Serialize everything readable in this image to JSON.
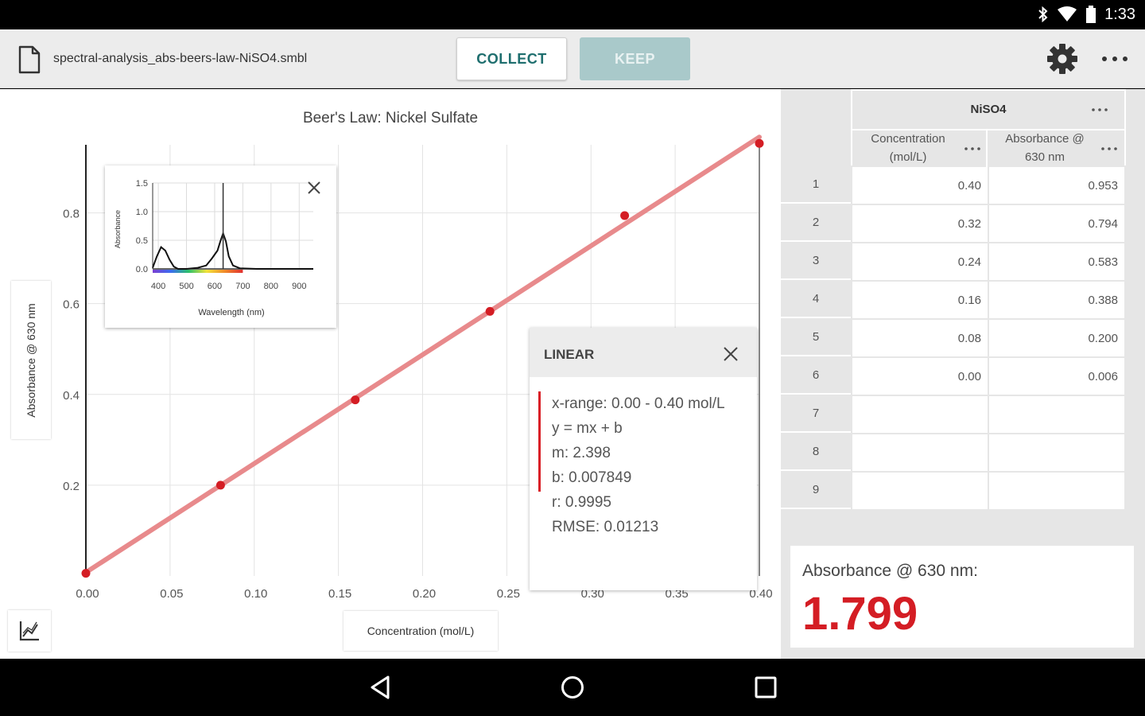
{
  "status_bar": {
    "time": "1:33",
    "icons": [
      "bluetooth-icon",
      "wifi-icon",
      "battery-icon"
    ]
  },
  "toolbar": {
    "file_name": "spectral-analysis_abs-beers-law-NiSO4.smbl",
    "collect_label": "COLLECT",
    "keep_label": "KEEP"
  },
  "chart_data": {
    "type": "scatter",
    "title": "Beer's Law: Nickel Sulfate",
    "xlabel": "Concentration (mol/L)",
    "ylabel": "Absorbance @ 630 nm",
    "xlim": [
      0.0,
      0.4
    ],
    "ylim": [
      0.0,
      0.95
    ],
    "x_ticks": [
      "0.00",
      "0.05",
      "0.10",
      "0.15",
      "0.20",
      "0.25",
      "0.30",
      "0.35",
      "0.40"
    ],
    "y_ticks": [
      "0.2",
      "0.4",
      "0.6",
      "0.8"
    ],
    "x_tick_values": [
      0,
      0.05,
      0.1,
      0.15,
      0.2,
      0.25,
      0.3,
      0.35,
      0.4
    ],
    "y_tick_values": [
      0.2,
      0.4,
      0.6,
      0.8
    ],
    "grid": true,
    "points": [
      {
        "x": 0.0,
        "y": 0.006
      },
      {
        "x": 0.08,
        "y": 0.2
      },
      {
        "x": 0.16,
        "y": 0.388
      },
      {
        "x": 0.24,
        "y": 0.583
      },
      {
        "x": 0.32,
        "y": 0.794
      },
      {
        "x": 0.4,
        "y": 0.953
      }
    ],
    "fit": {
      "m": 2.398,
      "b": 0.007849
    },
    "point_color": "#d41d24",
    "fit_color": "#e88a8c"
  },
  "inset": {
    "xlabel": "Wavelength (nm)",
    "ylabel": "Absorbance",
    "x_ticks": [
      "400",
      "500",
      "600",
      "700",
      "800",
      "900"
    ],
    "y_ticks": [
      "0.0",
      "0.5",
      "1.0",
      "1.5"
    ],
    "x_tick_values": [
      400,
      500,
      600,
      700,
      800,
      900
    ],
    "y_tick_values": [
      0.0,
      0.5,
      1.0,
      1.5
    ],
    "xlim": [
      380,
      950
    ],
    "ylim": [
      0,
      1.5
    ],
    "marker_wavelength": 630,
    "spectrum": [
      [
        380,
        0.02
      ],
      [
        395,
        0.22
      ],
      [
        410,
        0.38
      ],
      [
        425,
        0.32
      ],
      [
        440,
        0.16
      ],
      [
        455,
        0.04
      ],
      [
        470,
        0.0
      ],
      [
        500,
        0.0
      ],
      [
        540,
        0.02
      ],
      [
        570,
        0.06
      ],
      [
        590,
        0.18
      ],
      [
        610,
        0.32
      ],
      [
        620,
        0.48
      ],
      [
        630,
        0.62
      ],
      [
        640,
        0.48
      ],
      [
        650,
        0.22
      ],
      [
        665,
        0.06
      ],
      [
        690,
        0.01
      ],
      [
        750,
        0.0
      ],
      [
        850,
        0.0
      ],
      [
        950,
        0.0
      ]
    ]
  },
  "linear": {
    "title": "LINEAR",
    "x_range": "x-range: 0.00 - 0.40 mol/L",
    "equation": "y = mx + b",
    "m": "m: 2.398",
    "b": "b: 0.007849",
    "r": "r: 0.9995",
    "rmse": "RMSE: 0.01213"
  },
  "table": {
    "group_title": "NiSO4",
    "col1_header": [
      "Concentration",
      "(mol/L)"
    ],
    "col2_header": [
      "Absorbance @",
      "630 nm"
    ],
    "rows": [
      {
        "n": "1",
        "c": "0.40",
        "a": "0.953"
      },
      {
        "n": "2",
        "c": "0.32",
        "a": "0.794"
      },
      {
        "n": "3",
        "c": "0.24",
        "a": "0.583"
      },
      {
        "n": "4",
        "c": "0.16",
        "a": "0.388"
      },
      {
        "n": "5",
        "c": "0.08",
        "a": "0.200"
      },
      {
        "n": "6",
        "c": "0.00",
        "a": "0.006"
      },
      {
        "n": "7",
        "c": "",
        "a": ""
      },
      {
        "n": "8",
        "c": "",
        "a": ""
      },
      {
        "n": "9",
        "c": "",
        "a": ""
      }
    ]
  },
  "sensor": {
    "label": "Absorbance @ 630 nm:",
    "value": "1.799"
  }
}
